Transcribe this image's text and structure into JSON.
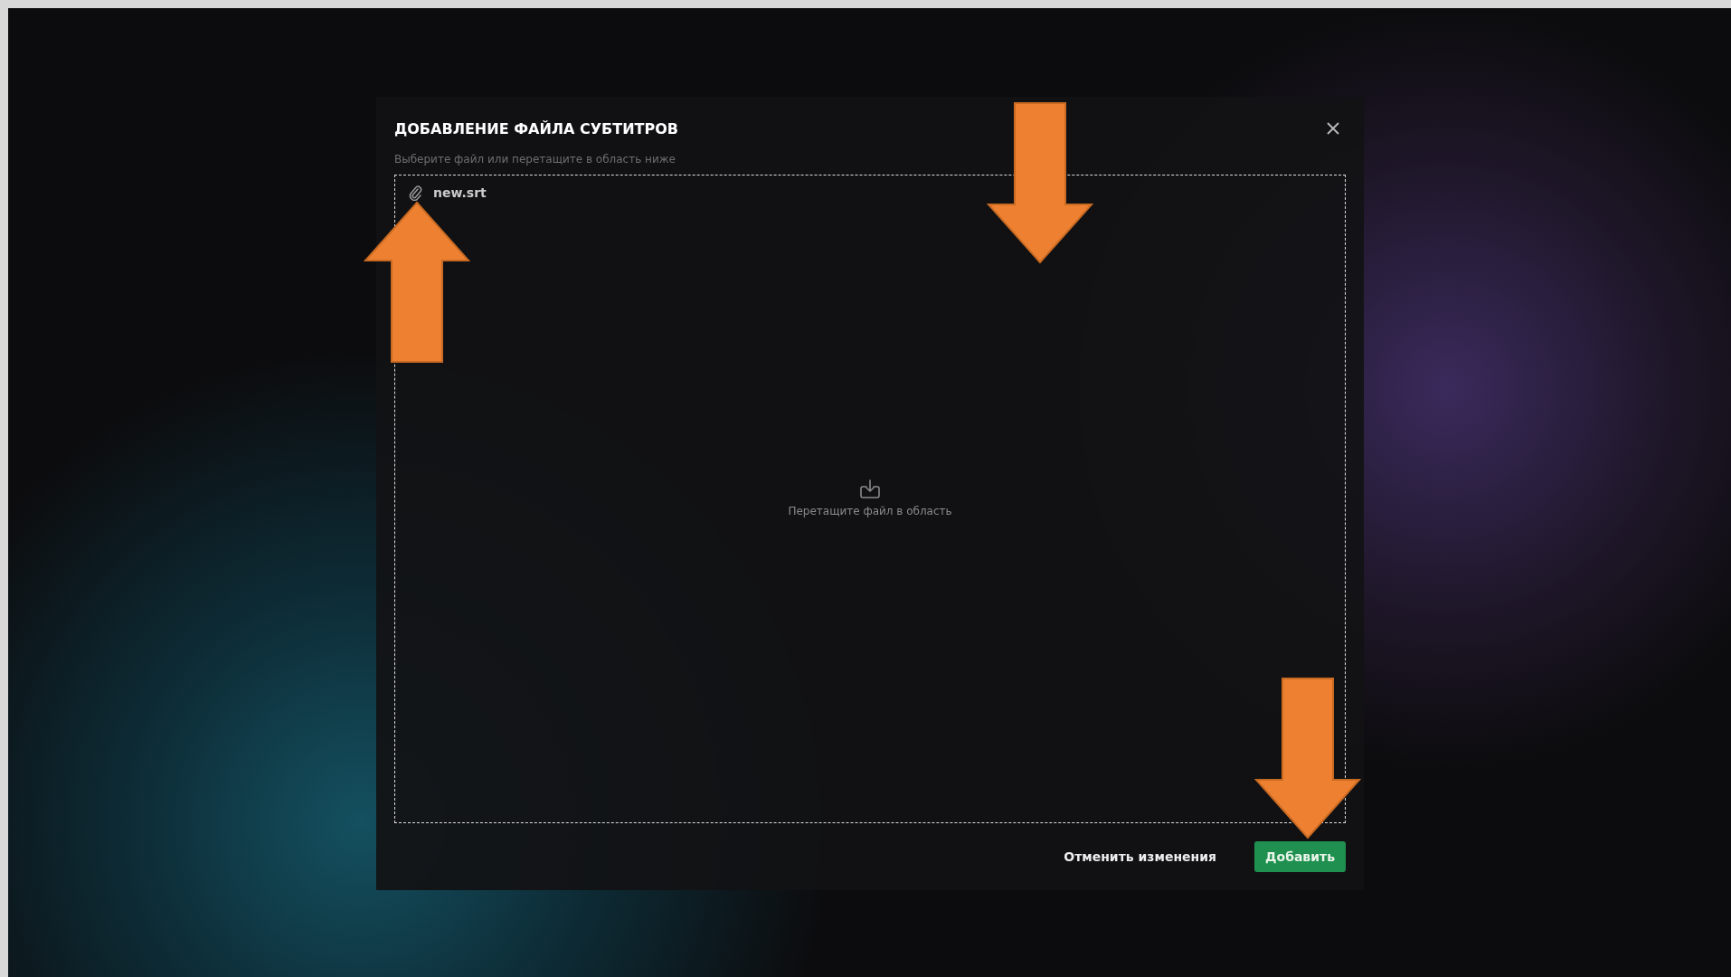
{
  "dialog": {
    "title": "ДОБАВЛЕНИЕ ФАЙЛА СУБТИТРОВ",
    "hint": "Выберите файл или перетащите в область ниже",
    "attached_file": "new.srt",
    "drop_text": "Перетащите файл в область",
    "buttons": [
      {
        "kind": "secondary",
        "label": "Отменить изменения"
      },
      {
        "kind": "primary",
        "label": "Добавить"
      }
    ]
  }
}
